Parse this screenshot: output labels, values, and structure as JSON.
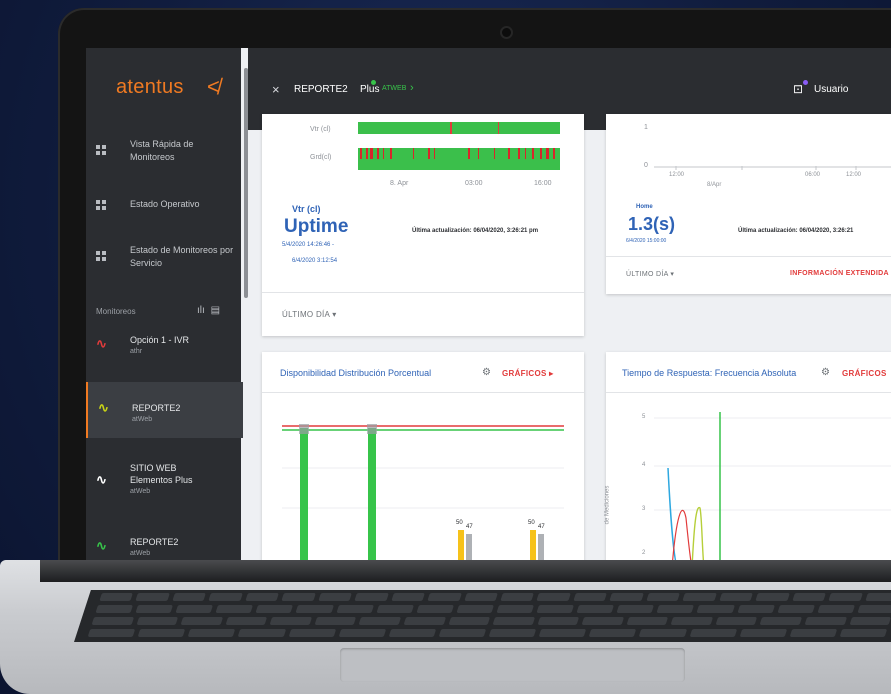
{
  "sidebar": {
    "logo": "atentus",
    "items": [
      {
        "label": "Vista Rápida de Monitoreos",
        "icon": "grid-icon"
      },
      {
        "label": "Estado Operativo",
        "icon": "grid-icon"
      },
      {
        "label": "Estado de Monitoreos por Servicio",
        "icon": "grid-icon"
      }
    ],
    "section_label": "Monitoreos",
    "monitors": [
      {
        "name": "Opción 1 - IVR",
        "sub": "athr",
        "trend_color": "#e23b3b"
      },
      {
        "name": "REPORTE2",
        "sub": "atWeb",
        "trend_color": "#c9d416"
      },
      {
        "name": "SITIO WEB Elementos Plus",
        "sub": "atWeb",
        "trend_color": "#ffffff"
      },
      {
        "name": "REPORTE2",
        "sub": "atWeb",
        "trend_color": "#37c44a"
      }
    ]
  },
  "topbar": {
    "close": "×",
    "title": "REPORTE2",
    "plus": "Plus",
    "plus_tag": "ATWEB",
    "chevron": "›",
    "user": "Usuario"
  },
  "card1": {
    "row1_label": "Vtr (cl)",
    "row2_label": "Grd(cl)",
    "axis_ticks": [
      "8. Apr",
      "03:00",
      "16:00"
    ],
    "metric_label": "Vtr (cl)",
    "metric_value": "Uptime",
    "date_from": "5/4/2020 14:26:46 -",
    "date_to": "6/4/2020 3:12:54",
    "updated": "Última actualización: 06/04/2020, 3:26:21 pm",
    "footer_link": "ÚLTIMO DÍA ▾"
  },
  "card2": {
    "y_ticks": [
      "1",
      "0"
    ],
    "x_ticks": [
      "12:00",
      "8/Apr",
      "06:00",
      "12:00"
    ],
    "metric_label": "Home",
    "metric_value": "1.3(s)",
    "metric_date": "6/4/2020 15:00:00",
    "updated": "Última actualización: 06/04/2020, 3:26:21",
    "footer_link": "ÚLTIMO DÍA ▾",
    "extended": "INFORMACIÓN EXTENDIDA"
  },
  "card3": {
    "title": "Disponibilidad Distribución Porcentual",
    "action": "GRÁFICOS ▸",
    "bar_labels": [
      "50",
      "47",
      "50",
      "47"
    ]
  },
  "card4": {
    "title": "Tiempo de Respuesta: Frecuencia Absoluta",
    "action": "GRÁFICOS",
    "y_ticks": [
      "5",
      "4",
      "3",
      "2"
    ],
    "y_label": "de Mediciones"
  },
  "colors": {
    "accent": "#f07a22",
    "link_blue": "#2f63b6",
    "ok_green": "#37c44a",
    "alert_red": "#e23b3b",
    "warn_yellow": "#f6c21a"
  }
}
